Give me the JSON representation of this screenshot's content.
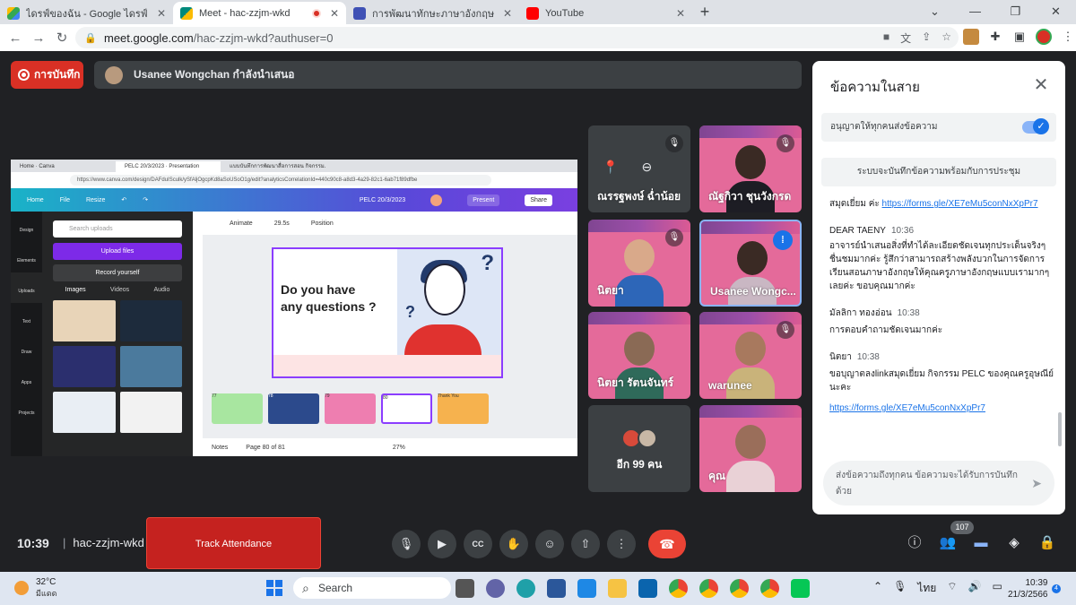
{
  "browser": {
    "tabs": [
      {
        "title": "ไดรฟ์ของฉัน - Google ไดรฟ์",
        "color": "#34a853",
        "active": false
      },
      {
        "title": "Meet - hac-zzjm-wkd",
        "color": "#00897b",
        "active": true
      },
      {
        "title": "การพัฒนาทักษะภาษาอังกฤษ English",
        "color": "#3f51b5",
        "active": false
      },
      {
        "title": "YouTube",
        "color": "#ff0000",
        "active": false
      }
    ],
    "url_host": "meet.google.com",
    "url_path": "/hac-zzjm-wkd?authuser=0"
  },
  "meet": {
    "record_label": "การบันทึก",
    "presenter_text": "Usanee Wongchan กำลังนำเสนอ",
    "clock": "10:39",
    "meeting_code": "hac-zzjm-wkd",
    "attendance_label": "Track Attendance",
    "people_count": "107"
  },
  "shared_screen": {
    "tabs": [
      "Home · Canva",
      "PELC 20/3/2023 · Presentation",
      "แบบบันทึกการพัฒนาสื่อการสอน กิจกรรม..."
    ],
    "url": "https://www.canva.com/design/DAFduISculk/ySfAljOgcpKd8aSoUSoO1g/edit?analyticsCorrelationId=440c90c8-a8d3-4a29-82c1-6ab71f89dfbe",
    "menu": [
      "Home",
      "File",
      "Resize"
    ],
    "doc_title": "PELC 20/3/2023",
    "present_label": "Present",
    "share_label": "Share",
    "sidebar": [
      "Design",
      "Elements",
      "Uploads",
      "Text",
      "Draw",
      "Apps",
      "Projects"
    ],
    "search_placeholder": "Search uploads",
    "upload_label": "Upload files",
    "record_label": "Record yourself",
    "subtabs": [
      "Images",
      "Videos",
      "Audio"
    ],
    "editor_bar": [
      "Animate",
      "29.5s",
      "Position"
    ],
    "slide_text_1": "Do you have",
    "slide_text_2": "any questions ?",
    "strip_numbers": [
      "77",
      "78",
      "79",
      "80",
      "81"
    ],
    "thank_you": "Thank You",
    "notes_label": "Notes",
    "page_label": "Page 80 of 81",
    "zoom": "27%"
  },
  "participants": [
    {
      "name": "ณรรฐพงษ์ ฉ่ำน้อย",
      "type": "no-video"
    },
    {
      "name": "ณัฐกิวา ชุนวังกรด",
      "type": "video"
    },
    {
      "name": "นิตยา",
      "type": "video"
    },
    {
      "name": "Usanee Wongc...",
      "type": "video"
    },
    {
      "name": "นิตยา รัตนจันทร์",
      "type": "video"
    },
    {
      "name": "warunee",
      "type": "video"
    },
    {
      "name": "อีก 99 คน",
      "type": "more"
    },
    {
      "name": "คุณ",
      "type": "video"
    }
  ],
  "chat": {
    "title": "ข้อความในสาย",
    "allow_label": "อนุญาตให้ทุกคนส่งข้อความ",
    "notice": "ระบบจะบันทึกข้อความพร้อมกับการประชุม",
    "messages": [
      {
        "sender": "",
        "time": "",
        "text": "สมุดเยี่ยม ค่ะ",
        "link": "https://forms.gle/XE7eMu5conNxXpPr7"
      },
      {
        "sender": "DEAR TAENY",
        "time": "10:36",
        "text": "อาจารย์นำเสนอสิ่งที่ทำได้ละเอียดชัดเจนทุกประเด็นจริงๆ ชื่นชมมากค่ะ รู้สึกว่าสามารถสร้างพลังบวกในการจัดการเรียนสอนภาษาอังกฤษให้คุณครูภาษาอังกฤษแบบเรามากๆ เลยค่ะ ขอบคุณมากค่ะ",
        "link": ""
      },
      {
        "sender": "มัลลิกา ทองอ่อน",
        "time": "10:38",
        "text": "การตอบคำถามชัดเจนมากค่ะ",
        "link": ""
      },
      {
        "sender": "นิตยา",
        "time": "10:38",
        "text": "ขอบุญาตลงlinkสมุดเยี่ยม กิจกรรม PELC ของคุณครูอุษณีย์นะคะ",
        "link": "https://forms.gle/XE7eMu5conNxXpPr7"
      }
    ],
    "input_placeholder": "ส่งข้อความถึงทุกคน ข้อความจะได้รับการบันทึกด้วย"
  },
  "taskbar": {
    "temp": "32°C",
    "weather": "มีแดด",
    "search": "Search",
    "lang": "ไทย",
    "time": "10:39",
    "date": "21/3/2566",
    "notifications": "4"
  }
}
